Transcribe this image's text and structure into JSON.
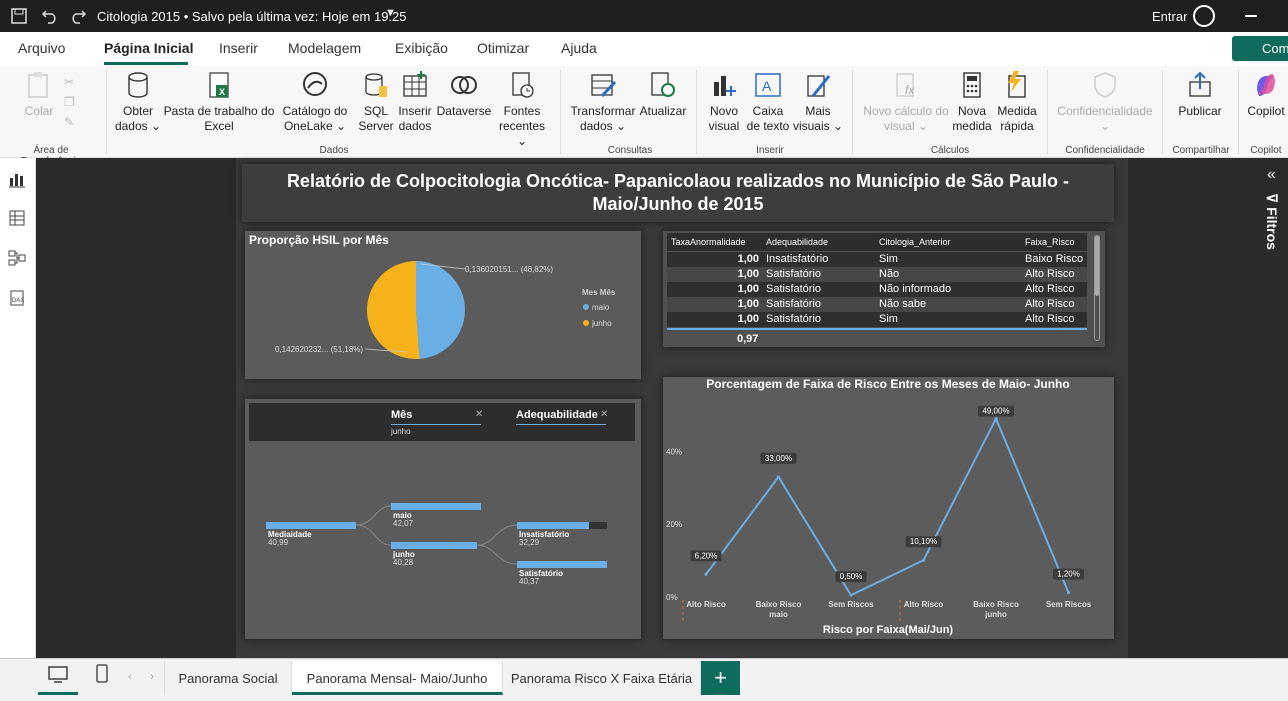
{
  "titlebar": {
    "doc_title": "Citologia 2015 • Salvo pela última vez: Hoje em 19:25",
    "signin": "Entrar"
  },
  "menu": {
    "items": [
      "Arquivo",
      "Página Inicial",
      "Inserir",
      "Modelagem",
      "Exibição",
      "Otimizar",
      "Ajuda"
    ],
    "comment": "Com"
  },
  "ribbon": {
    "paste": "Colar",
    "get_data": "Obter dados",
    "excel": "Pasta de trabalho do Excel",
    "onelake": "Catálogo do OneLake",
    "sql": "SQL Server",
    "insert_data": "Inserir dados",
    "dataverse": "Dataverse",
    "recent": "Fontes recentes",
    "transform": "Transformar dados",
    "refresh": "Atualizar",
    "new_visual": "Novo visual",
    "text_box": "Caixa de texto",
    "more_visuals": "Mais visuais",
    "new_calc": "Novo cálculo do visual",
    "new_measure": "Nova medida",
    "quick_measure": "Medida rápida",
    "sensitivity": "Confidencialidade",
    "publish": "Publicar",
    "copilot": "Copilot",
    "groups": {
      "clipboard": "Área de Transferência",
      "data": "Dados",
      "queries": "Consultas",
      "insert": "Inserir",
      "calcs": "Cálculos",
      "sensitivity": "Confidencialidade",
      "share": "Compartilhar",
      "copilot": "Copilot"
    }
  },
  "filters_label": "Filtros",
  "report": {
    "title_line1": "Relatório de Colpocitologia Oncótica- Papanicolaou realizados no Município de São Paulo  -",
    "title_line2": "Maio/Junho de 2015",
    "pie": {
      "title": "Proporção HSIL por Mês",
      "legend_title": "Mes Mês",
      "label_maio": "0,136020151... (48,82%)",
      "label_junho": "0,142620232... (51,18%)",
      "color_maio": "#6aaee6",
      "color_junho": "#f6b21b"
    },
    "table": {
      "headers": [
        "TaxaAnormalidade",
        "Adequabilidade",
        "Citologia_Anterior",
        "Faixa_Risco"
      ],
      "total": "0,97"
    },
    "tree": {
      "field1": "Mês",
      "field1_value": "junho",
      "field2": "Adequabilidade",
      "root_label": "Mediaidade",
      "root_value": "40,99",
      "maio_label": "maio",
      "maio_value": "42,07",
      "junho_label": "junho",
      "junho_value": "40,28",
      "insat_label": "Insatisfatório",
      "insat_value": "32,29",
      "sat_label": "Satisfatório",
      "sat_value": "40,37"
    },
    "line": {
      "title": "Porcentagem de Faixa de Risco Entre os Meses de Maio- Junho",
      "xlabel": "Risco por Faixa(Mai/Jun)"
    }
  },
  "table_rows": [
    [
      "1,00",
      "Insatisfatório",
      "Sim",
      "Baixo Risco"
    ],
    [
      "1,00",
      "Satisfatório",
      "Não",
      "Alto Risco"
    ],
    [
      "1,00",
      "Satisfatório",
      "Não informado",
      "Alto Risco"
    ],
    [
      "1,00",
      "Satisfatório",
      "Não sabe",
      "Alto Risco"
    ],
    [
      "1,00",
      "Satisfatório",
      "Sim",
      "Alto Risco"
    ]
  ],
  "chart_data": [
    {
      "type": "pie",
      "title": "Proporção HSIL por Mês",
      "legend": "Mes Mês",
      "categories": [
        "maio",
        "junho"
      ],
      "values": [
        0.13602,
        0.14262
      ],
      "percent": [
        48.82,
        51.18
      ]
    },
    {
      "type": "line",
      "title": "Porcentagem de Faixa de Risco Entre os Meses de Maio- Junho",
      "xlabel": "Risco por Faixa(Mai/Jun)",
      "categories": [
        "Alto Risco",
        "Baixo Risco maio",
        "Sem Riscos",
        "Alto Risco",
        "Baixo Risco junho",
        "Sem Riscos"
      ],
      "values": [
        6.2,
        33.0,
        0.5,
        10.1,
        49.0,
        1.2
      ],
      "labels": [
        "6,20%",
        "33,00%",
        "0,50%",
        "10,10%",
        "49,00%",
        "1,20%"
      ],
      "yticks": [
        "0%",
        "20%",
        "40%"
      ],
      "ylim": [
        0,
        50
      ],
      "color": "#6aaee6"
    }
  ],
  "tabs": [
    "Panorama Social",
    "Panorama Mensal- Maio/Junho",
    "Panorama Risco X Faixa Etária"
  ]
}
